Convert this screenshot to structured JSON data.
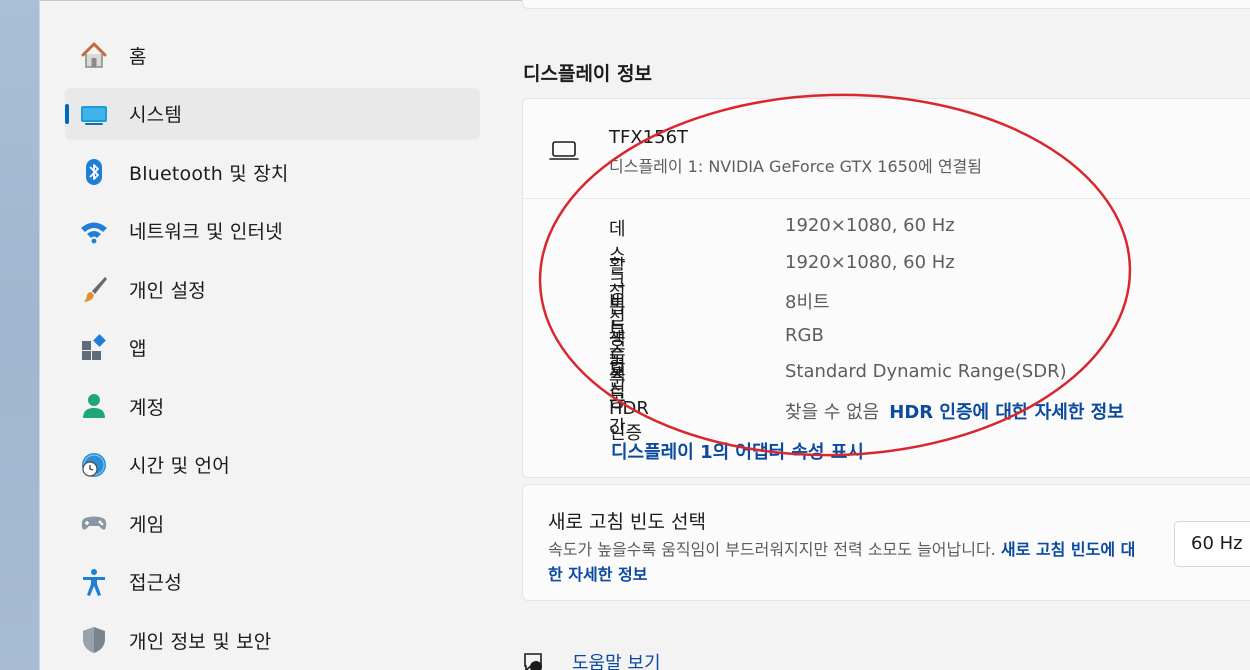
{
  "sidebar": {
    "items": [
      {
        "label": "홈",
        "icon": "home-icon"
      },
      {
        "label": "시스템",
        "icon": "system-icon",
        "selected": true
      },
      {
        "label": "Bluetooth 및 장치",
        "icon": "bluetooth-icon"
      },
      {
        "label": "네트워크 및 인터넷",
        "icon": "wifi-icon"
      },
      {
        "label": "개인 설정",
        "icon": "paintbrush-icon"
      },
      {
        "label": "앱",
        "icon": "apps-icon"
      },
      {
        "label": "계정",
        "icon": "account-icon"
      },
      {
        "label": "시간 및 언어",
        "icon": "time-language-icon"
      },
      {
        "label": "게임",
        "icon": "gamepad-icon"
      },
      {
        "label": "접근성",
        "icon": "accessibility-icon"
      },
      {
        "label": "개인 정보 및 보안",
        "icon": "shield-icon"
      }
    ]
  },
  "display_info": {
    "section_title": "디스플레이 정보",
    "monitor_name": "TFX156T",
    "monitor_sub": "디스플레이 1: NVIDIA GeForce GTX 1650에 연결됨",
    "specs": [
      {
        "label": "데스크톱 모드",
        "value": "1920×1080, 60 Hz"
      },
      {
        "label": "활성 신호 모드",
        "value": "1920×1080, 60 Hz"
      },
      {
        "label": "비트 수준",
        "value": "8비트"
      },
      {
        "label": "색 형식",
        "value": "RGB"
      },
      {
        "label": "색 공간",
        "value": "Standard Dynamic Range(SDR)"
      },
      {
        "label": "HDR 인증",
        "value": "찾을 수 없음",
        "link": "HDR 인증에 대한 자세한 정보"
      }
    ],
    "adapter_link": "디스플레이 1의 어댑터 속성 표시"
  },
  "refresh": {
    "title": "새로 고침 빈도 선택",
    "description": "속도가 높을수록 움직임이 부드러워지지만 전력 소모도 늘어납니다.",
    "link": "새로 고침 빈도에 대한 자세한 정보",
    "selected_rate": "60 Hz"
  },
  "help": {
    "label": "도움말 보기"
  },
  "colors": {
    "accent": "#0067c0",
    "link": "#0b4a9e",
    "annotation": "#d9272e"
  }
}
